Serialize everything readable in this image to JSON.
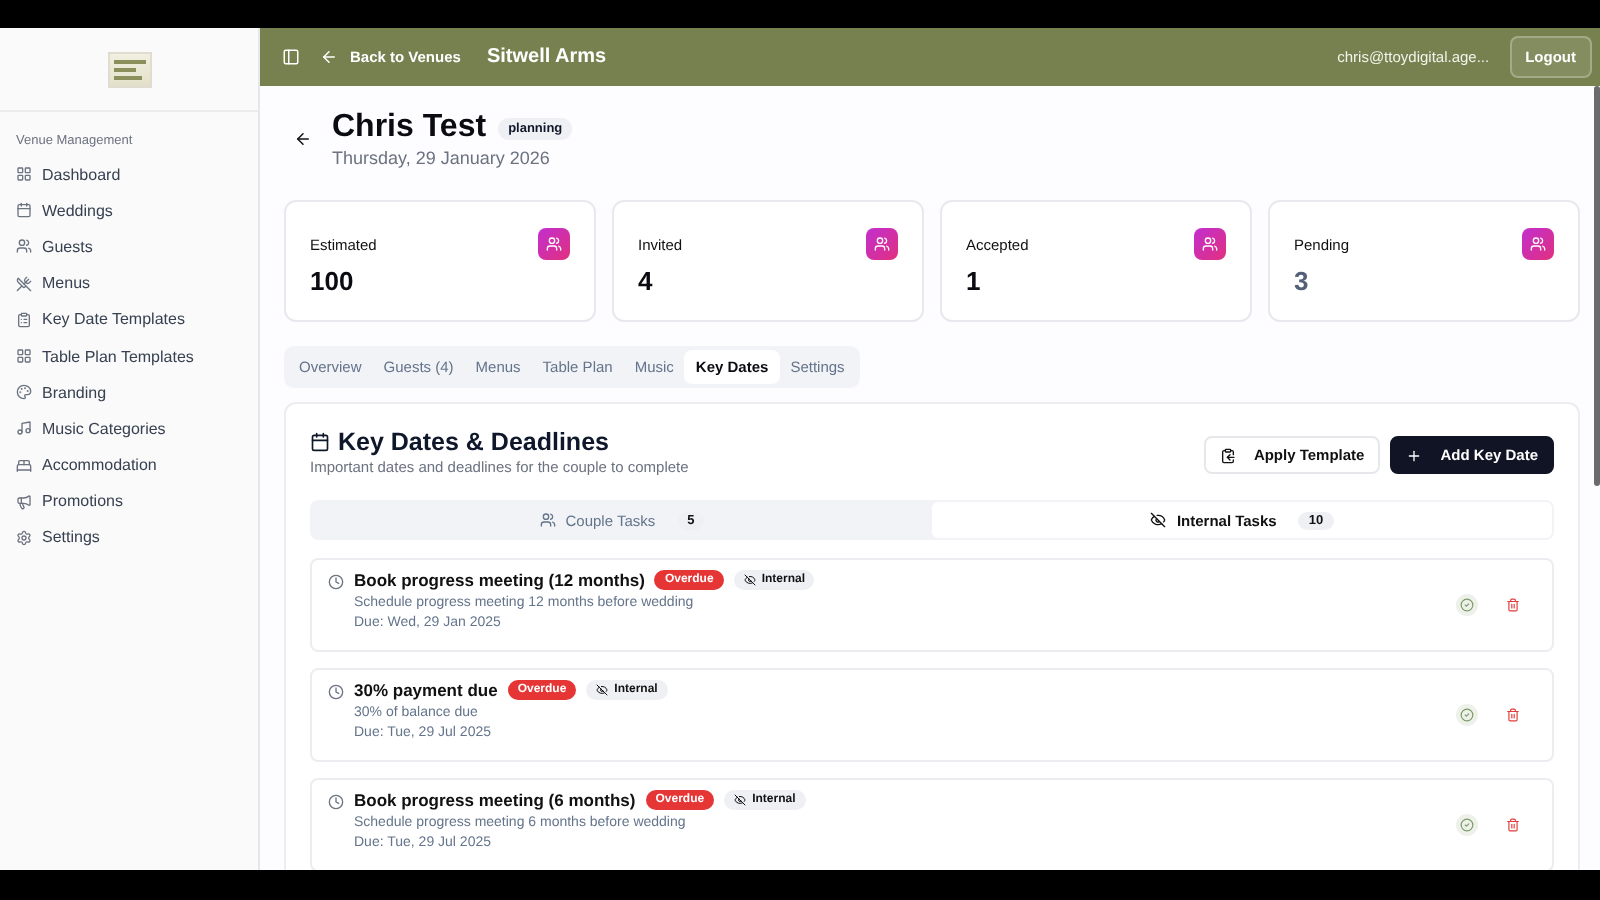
{
  "sidebar": {
    "section_title": "Venue Management",
    "items": [
      {
        "label": "Dashboard",
        "selected": false
      },
      {
        "label": "Weddings",
        "selected": false
      },
      {
        "label": "Guests",
        "selected": false
      },
      {
        "label": "Menus",
        "selected": false
      },
      {
        "label": "Key Date Templates",
        "selected": false
      },
      {
        "label": "Table Plan Templates",
        "selected": false
      },
      {
        "label": "Branding",
        "selected": false
      },
      {
        "label": "Music Categories",
        "selected": false
      },
      {
        "label": "Accommodation",
        "selected": false
      },
      {
        "label": "Promotions",
        "selected": false
      },
      {
        "label": "Settings",
        "selected": false
      }
    ]
  },
  "topbar": {
    "back_link": "Back to Venues",
    "venue": "Sitwell Arms",
    "user": "chris@ttoydigital.age...",
    "logout": "Logout"
  },
  "header": {
    "title": "Chris Test",
    "status": "planning",
    "date": "Thursday, 29 January 2026"
  },
  "stats": [
    {
      "label": "Estimated",
      "value": "100",
      "muted": false
    },
    {
      "label": "Invited",
      "value": "4",
      "muted": false
    },
    {
      "label": "Accepted",
      "value": "1",
      "muted": false
    },
    {
      "label": "Pending",
      "value": "3",
      "muted": true
    }
  ],
  "tabs": [
    {
      "label": "Overview",
      "selected": false
    },
    {
      "label": "Guests (4)",
      "selected": false
    },
    {
      "label": "Menus",
      "selected": false
    },
    {
      "label": "Table Plan",
      "selected": false
    },
    {
      "label": "Music",
      "selected": false
    },
    {
      "label": "Key Dates",
      "selected": true
    },
    {
      "label": "Settings",
      "selected": false
    }
  ],
  "key_dates": {
    "title": "Key Dates & Deadlines",
    "subtitle": "Important dates and deadlines for the couple to complete",
    "apply_button": "Apply Template",
    "add_button": "Add Key Date",
    "task_tabs": [
      {
        "label": "Couple Tasks",
        "count": "5",
        "selected": false
      },
      {
        "label": "Internal Tasks",
        "count": "10",
        "selected": true
      }
    ],
    "tasks": [
      {
        "title": "Book progress meeting (12 months)",
        "status": "Overdue",
        "visibility": "Internal",
        "description": "Schedule progress meeting 12 months before wedding",
        "due": "Due: Wed, 29 Jan 2025"
      },
      {
        "title": "30% payment due",
        "status": "Overdue",
        "visibility": "Internal",
        "description": "30% of balance due",
        "due": "Due: Tue, 29 Jul 2025"
      },
      {
        "title": "Book progress meeting (6 months)",
        "status": "Overdue",
        "visibility": "Internal",
        "description": "Schedule progress meeting 6 months before wedding",
        "due": "Due: Tue, 29 Jul 2025"
      }
    ]
  }
}
